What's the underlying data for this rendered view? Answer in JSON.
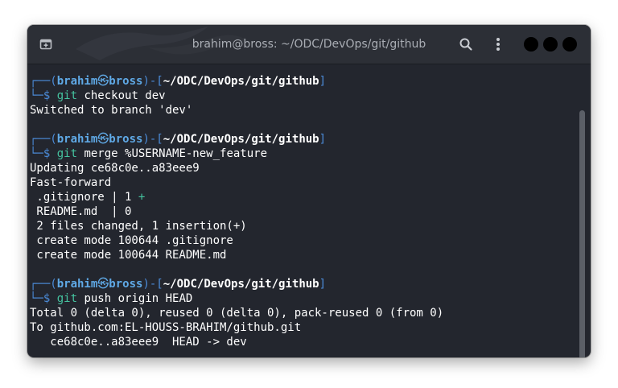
{
  "window": {
    "title": "brahim@bross: ~/ODC/DevOps/git/github",
    "icons": {
      "new_tab": "new-tab-icon",
      "search": "search-icon",
      "menu": "kebab-menu-icon",
      "controls": [
        "minimize-button",
        "maximize-button",
        "close-button"
      ]
    }
  },
  "colors": {
    "prompt_frame": "#4b8bd8",
    "user_host": "#5fa9e6",
    "command_git": "#45c4a0",
    "background": "#23262e"
  },
  "terminal": {
    "blocks": [
      {
        "prompt": {
          "frame_left": "┌──(",
          "user": "brahim",
          "at": "㉿",
          "host": "bross",
          "mid": ")-[",
          "path": "~/ODC/DevOps/git/github",
          "frame_right": "]",
          "line2_prefix": "└─$ ",
          "cmd": "git",
          "args": " checkout dev"
        },
        "output": [
          "Switched to branch 'dev'"
        ]
      },
      {
        "prompt": {
          "frame_left": "┌──(",
          "user": "brahim",
          "at": "㉿",
          "host": "bross",
          "mid": ")-[",
          "path": "~/ODC/DevOps/git/github",
          "frame_right": "]",
          "line2_prefix": "└─$ ",
          "cmd": "git",
          "args": " merge %USERNAME-new_feature"
        },
        "output": [
          "Updating ce68c0e..a83eee9",
          "Fast-forward",
          " .gitignore | 1 ",
          " README.md  | 0",
          " 2 files changed, 1 insertion(+)",
          " create mode 100644 .gitignore",
          " create mode 100644 README.md"
        ],
        "diffstat_plus": "+"
      },
      {
        "prompt": {
          "frame_left": "┌──(",
          "user": "brahim",
          "at": "㉿",
          "host": "bross",
          "mid": ")-[",
          "path": "~/ODC/DevOps/git/github",
          "frame_right": "]",
          "line2_prefix": "└─$ ",
          "cmd": "git",
          "args": " push origin HEAD"
        },
        "output": [
          "Total 0 (delta 0), reused 0 (delta 0), pack-reused 0 (from 0)",
          "To github.com:EL-HOUSS-BRAHIM/github.git",
          "   ce68c0e..a83eee9  HEAD -> dev"
        ]
      }
    ]
  }
}
